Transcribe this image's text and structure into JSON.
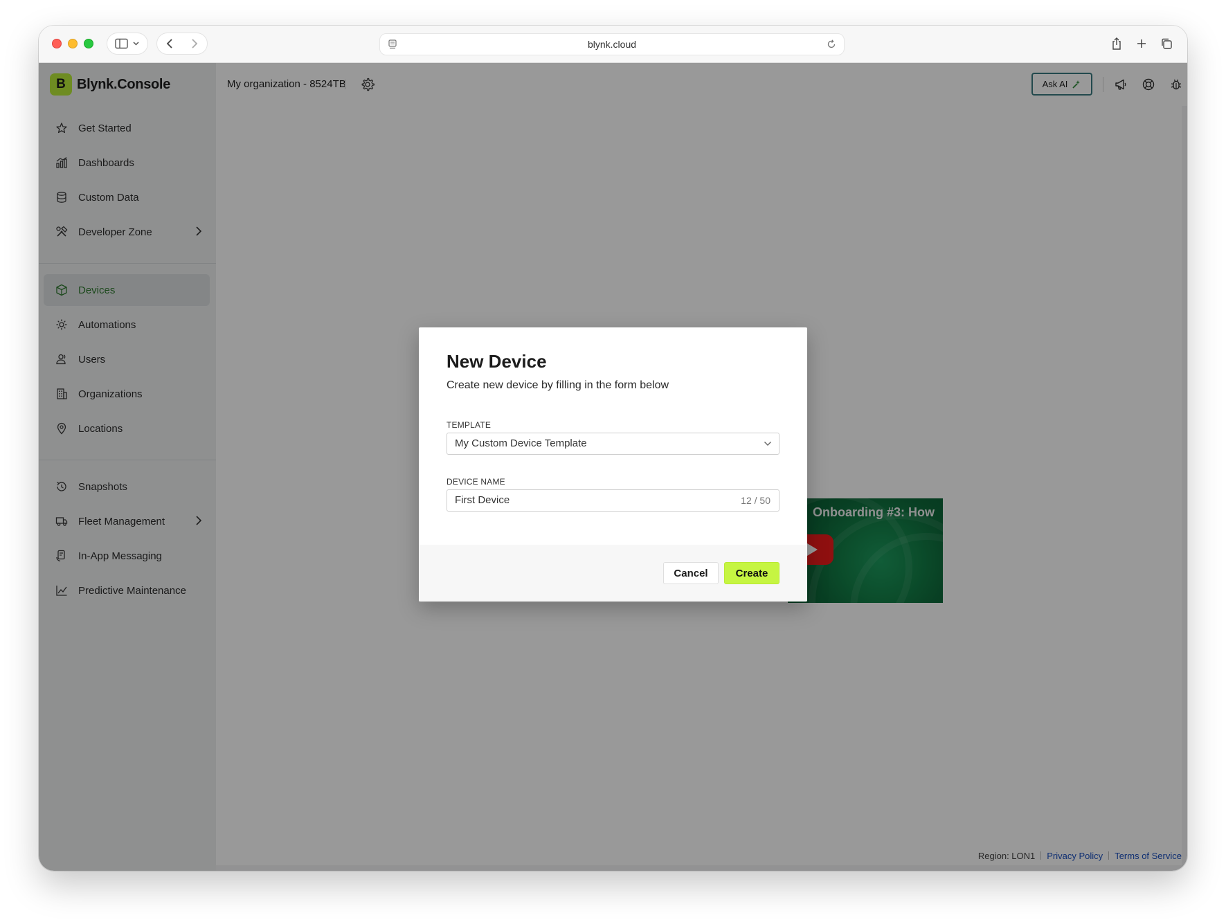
{
  "browser": {
    "url": "blynk.cloud"
  },
  "brand": {
    "badge": "B",
    "name": "Blynk.Console",
    "accent": "#b8ea3a"
  },
  "sidebar": {
    "items": [
      {
        "label": "Get Started",
        "icon": "star-icon"
      },
      {
        "label": "Dashboards",
        "icon": "bar-chart-icon"
      },
      {
        "label": "Custom Data",
        "icon": "database-icon"
      },
      {
        "label": "Developer Zone",
        "icon": "tools-icon"
      },
      {
        "label": "Devices",
        "icon": "cube-icon",
        "active": true
      },
      {
        "label": "Automations",
        "icon": "automation-icon"
      },
      {
        "label": "Users",
        "icon": "users-icon"
      },
      {
        "label": "Organizations",
        "icon": "building-icon"
      },
      {
        "label": "Locations",
        "icon": "pin-icon"
      },
      {
        "label": "Snapshots",
        "icon": "snapshot-icon"
      },
      {
        "label": "Fleet Management",
        "icon": "truck-icon"
      },
      {
        "label": "In-App Messaging",
        "icon": "message-icon"
      },
      {
        "label": "Predictive Maintenance",
        "icon": "line-chart-icon"
      }
    ]
  },
  "topbar": {
    "org_name": "My organization - 8524TB",
    "ask_ai_label": "Ask AI"
  },
  "video": {
    "title": "Onboarding #3: How"
  },
  "footer": {
    "region": "Region: LON1",
    "privacy": "Privacy Policy",
    "terms": "Terms of Service"
  },
  "modal": {
    "title": "New Device",
    "subtitle": "Create new device by filling in the form below",
    "template_label": "TEMPLATE",
    "template_value": "My Custom Device Template",
    "device_name_label": "DEVICE NAME",
    "device_name_value": "First Device",
    "device_name_counter": "12 / 50",
    "cancel_label": "Cancel",
    "create_label": "Create",
    "create_color": "#c6f542"
  }
}
